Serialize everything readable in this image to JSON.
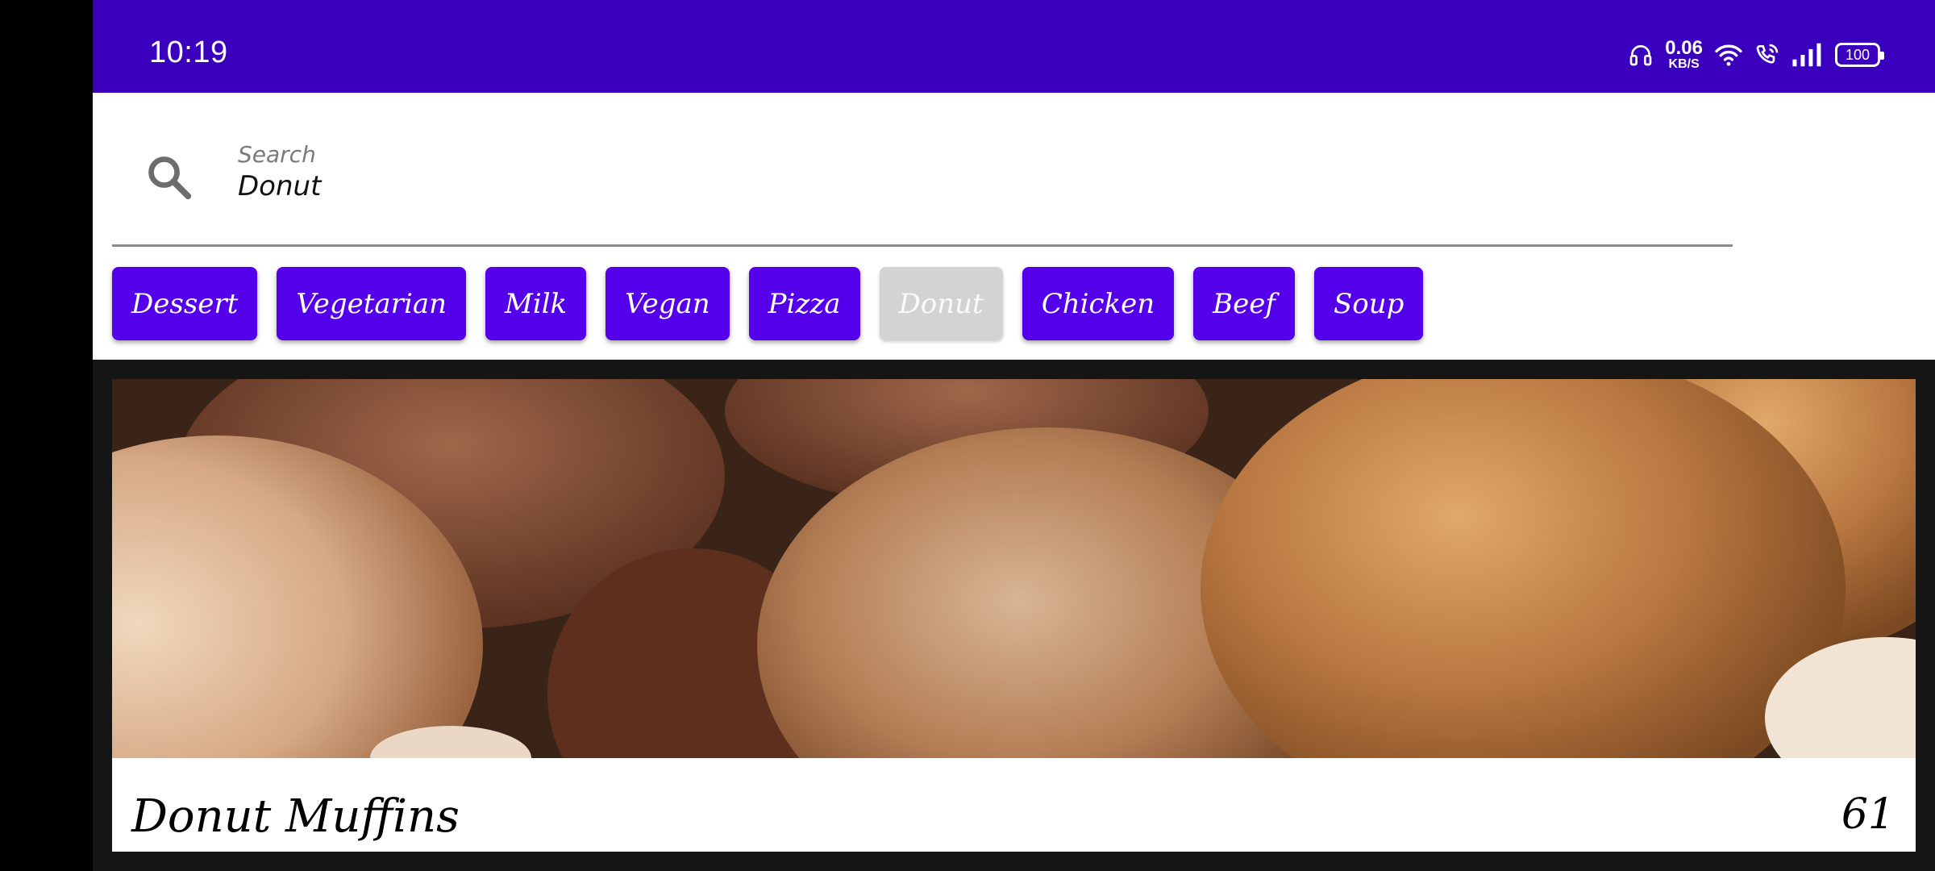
{
  "status_bar": {
    "time": "10:19",
    "net_speed_value": "0.06",
    "net_speed_unit": "KB/S",
    "battery": "100",
    "background_color": "#3a00bd"
  },
  "search": {
    "label": "Search",
    "value": "Donut",
    "icon": "search-icon"
  },
  "categories": [
    {
      "label": "Dessert",
      "selected": false
    },
    {
      "label": "Vegetarian",
      "selected": false
    },
    {
      "label": "Milk",
      "selected": false
    },
    {
      "label": "Vegan",
      "selected": false
    },
    {
      "label": "Pizza",
      "selected": false
    },
    {
      "label": "Donut",
      "selected": true
    },
    {
      "label": "Chicken",
      "selected": false
    },
    {
      "label": "Beef",
      "selected": false
    },
    {
      "label": "Soup",
      "selected": false
    }
  ],
  "chip_color": "#5500ea",
  "chip_selected_color": "#d3d3d3",
  "recipes": [
    {
      "title": "Donut Muffins",
      "count": "61",
      "image": "donut-muffins-photo"
    }
  ]
}
